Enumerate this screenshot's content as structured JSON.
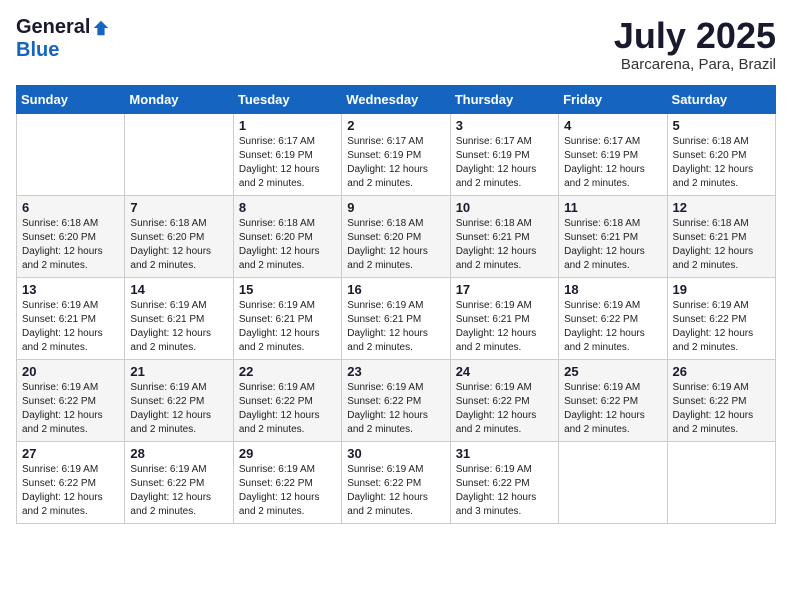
{
  "logo": {
    "general": "General",
    "blue": "Blue"
  },
  "title": {
    "month_year": "July 2025",
    "location": "Barcarena, Para, Brazil"
  },
  "weekdays": [
    "Sunday",
    "Monday",
    "Tuesday",
    "Wednesday",
    "Thursday",
    "Friday",
    "Saturday"
  ],
  "weeks": [
    [
      {
        "day": "",
        "info": ""
      },
      {
        "day": "",
        "info": ""
      },
      {
        "day": "1",
        "info": "Sunrise: 6:17 AM\nSunset: 6:19 PM\nDaylight: 12 hours\nand 2 minutes."
      },
      {
        "day": "2",
        "info": "Sunrise: 6:17 AM\nSunset: 6:19 PM\nDaylight: 12 hours\nand 2 minutes."
      },
      {
        "day": "3",
        "info": "Sunrise: 6:17 AM\nSunset: 6:19 PM\nDaylight: 12 hours\nand 2 minutes."
      },
      {
        "day": "4",
        "info": "Sunrise: 6:17 AM\nSunset: 6:19 PM\nDaylight: 12 hours\nand 2 minutes."
      },
      {
        "day": "5",
        "info": "Sunrise: 6:18 AM\nSunset: 6:20 PM\nDaylight: 12 hours\nand 2 minutes."
      }
    ],
    [
      {
        "day": "6",
        "info": "Sunrise: 6:18 AM\nSunset: 6:20 PM\nDaylight: 12 hours\nand 2 minutes."
      },
      {
        "day": "7",
        "info": "Sunrise: 6:18 AM\nSunset: 6:20 PM\nDaylight: 12 hours\nand 2 minutes."
      },
      {
        "day": "8",
        "info": "Sunrise: 6:18 AM\nSunset: 6:20 PM\nDaylight: 12 hours\nand 2 minutes."
      },
      {
        "day": "9",
        "info": "Sunrise: 6:18 AM\nSunset: 6:20 PM\nDaylight: 12 hours\nand 2 minutes."
      },
      {
        "day": "10",
        "info": "Sunrise: 6:18 AM\nSunset: 6:21 PM\nDaylight: 12 hours\nand 2 minutes."
      },
      {
        "day": "11",
        "info": "Sunrise: 6:18 AM\nSunset: 6:21 PM\nDaylight: 12 hours\nand 2 minutes."
      },
      {
        "day": "12",
        "info": "Sunrise: 6:18 AM\nSunset: 6:21 PM\nDaylight: 12 hours\nand 2 minutes."
      }
    ],
    [
      {
        "day": "13",
        "info": "Sunrise: 6:19 AM\nSunset: 6:21 PM\nDaylight: 12 hours\nand 2 minutes."
      },
      {
        "day": "14",
        "info": "Sunrise: 6:19 AM\nSunset: 6:21 PM\nDaylight: 12 hours\nand 2 minutes."
      },
      {
        "day": "15",
        "info": "Sunrise: 6:19 AM\nSunset: 6:21 PM\nDaylight: 12 hours\nand 2 minutes."
      },
      {
        "day": "16",
        "info": "Sunrise: 6:19 AM\nSunset: 6:21 PM\nDaylight: 12 hours\nand 2 minutes."
      },
      {
        "day": "17",
        "info": "Sunrise: 6:19 AM\nSunset: 6:21 PM\nDaylight: 12 hours\nand 2 minutes."
      },
      {
        "day": "18",
        "info": "Sunrise: 6:19 AM\nSunset: 6:22 PM\nDaylight: 12 hours\nand 2 minutes."
      },
      {
        "day": "19",
        "info": "Sunrise: 6:19 AM\nSunset: 6:22 PM\nDaylight: 12 hours\nand 2 minutes."
      }
    ],
    [
      {
        "day": "20",
        "info": "Sunrise: 6:19 AM\nSunset: 6:22 PM\nDaylight: 12 hours\nand 2 minutes."
      },
      {
        "day": "21",
        "info": "Sunrise: 6:19 AM\nSunset: 6:22 PM\nDaylight: 12 hours\nand 2 minutes."
      },
      {
        "day": "22",
        "info": "Sunrise: 6:19 AM\nSunset: 6:22 PM\nDaylight: 12 hours\nand 2 minutes."
      },
      {
        "day": "23",
        "info": "Sunrise: 6:19 AM\nSunset: 6:22 PM\nDaylight: 12 hours\nand 2 minutes."
      },
      {
        "day": "24",
        "info": "Sunrise: 6:19 AM\nSunset: 6:22 PM\nDaylight: 12 hours\nand 2 minutes."
      },
      {
        "day": "25",
        "info": "Sunrise: 6:19 AM\nSunset: 6:22 PM\nDaylight: 12 hours\nand 2 minutes."
      },
      {
        "day": "26",
        "info": "Sunrise: 6:19 AM\nSunset: 6:22 PM\nDaylight: 12 hours\nand 2 minutes."
      }
    ],
    [
      {
        "day": "27",
        "info": "Sunrise: 6:19 AM\nSunset: 6:22 PM\nDaylight: 12 hours\nand 2 minutes."
      },
      {
        "day": "28",
        "info": "Sunrise: 6:19 AM\nSunset: 6:22 PM\nDaylight: 12 hours\nand 2 minutes."
      },
      {
        "day": "29",
        "info": "Sunrise: 6:19 AM\nSunset: 6:22 PM\nDaylight: 12 hours\nand 2 minutes."
      },
      {
        "day": "30",
        "info": "Sunrise: 6:19 AM\nSunset: 6:22 PM\nDaylight: 12 hours\nand 2 minutes."
      },
      {
        "day": "31",
        "info": "Sunrise: 6:19 AM\nSunset: 6:22 PM\nDaylight: 12 hours\nand 3 minutes."
      },
      {
        "day": "",
        "info": ""
      },
      {
        "day": "",
        "info": ""
      }
    ]
  ]
}
